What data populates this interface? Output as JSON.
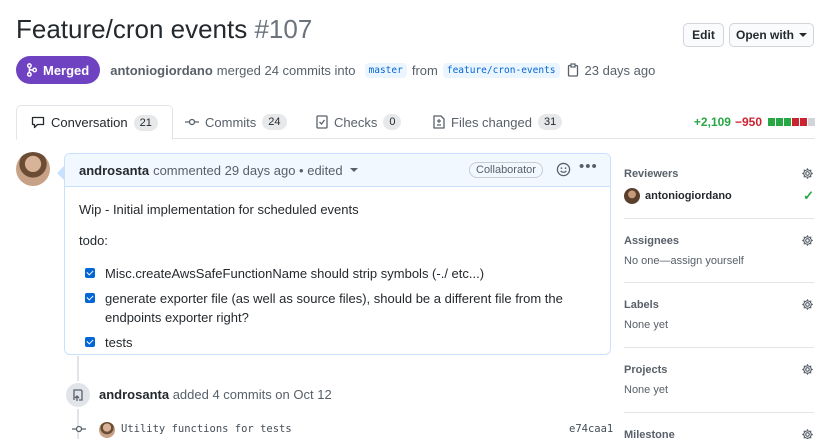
{
  "pr": {
    "title": "Feature/cron events",
    "number": "#107",
    "state": "Merged",
    "author": "antoniogiordano",
    "action": "merged 24 commits into",
    "base": "master",
    "from_word": "from",
    "head": "feature/cron-events",
    "age": "23 days ago"
  },
  "header_buttons": {
    "edit": "Edit",
    "open_with": "Open with"
  },
  "tabs": [
    {
      "label": "Conversation",
      "count": "21"
    },
    {
      "label": "Commits",
      "count": "24"
    },
    {
      "label": "Checks",
      "count": "0"
    },
    {
      "label": "Files changed",
      "count": "31"
    }
  ],
  "diffstat": {
    "additions": "+2,109",
    "deletions": "−950",
    "blocks": [
      "green",
      "green",
      "green",
      "red",
      "red",
      "gray"
    ]
  },
  "colors": {
    "merged": "#6f42c1",
    "green": "#28a745",
    "red": "#cb2431",
    "gray": "#d1d5da",
    "link": "#0366d6"
  },
  "comment": {
    "author": "androsanta",
    "meta": "commented 29 days ago • edited",
    "role": "Collaborator",
    "body_title": "Wip - Initial implementation for scheduled events",
    "todo_label": "todo:",
    "tasks": [
      "Misc.createAwsSafeFunctionName should strip symbols (-./ etc...)",
      "generate exporter file (as well as source files), should be a different file from the endpoints exporter right?",
      "tests"
    ]
  },
  "timeline_event": {
    "actor": "androsanta",
    "text": "added 4 commits on Oct 12"
  },
  "commits": [
    {
      "message": "Utility functions for tests",
      "sha": "e74caa1"
    }
  ],
  "sidebar": {
    "reviewers": {
      "title": "Reviewers",
      "value": "antoniogiordano"
    },
    "assignees": {
      "title": "Assignees",
      "value": "No one—assign yourself"
    },
    "labels": {
      "title": "Labels",
      "value": "None yet"
    },
    "projects": {
      "title": "Projects",
      "value": "None yet"
    },
    "milestone": {
      "title": "Milestone"
    }
  },
  "icons": [
    "merge-icon",
    "copy-icon",
    "comment-icon",
    "commit-icon",
    "checks-icon",
    "file-diff-icon",
    "smiley-icon",
    "kebab-icon",
    "push-icon",
    "gear-icon",
    "check-icon"
  ]
}
